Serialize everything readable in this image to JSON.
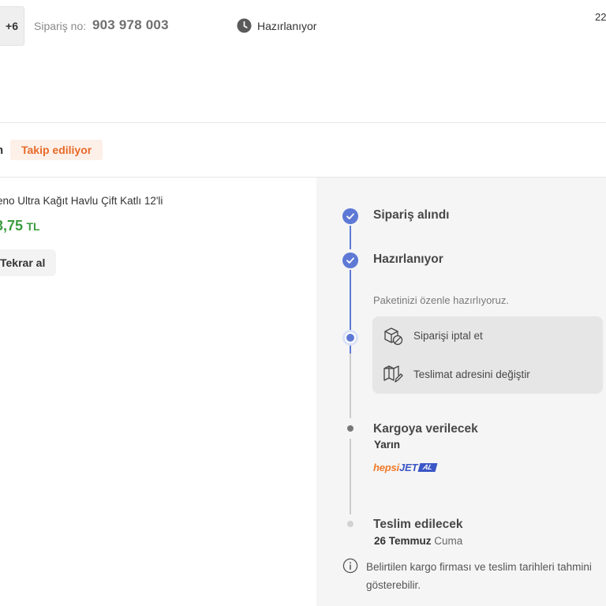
{
  "header": {
    "more_items": "+6",
    "order_label": "Sipariş no:",
    "order_number": "903 978 003",
    "status": "Hazırlanıyor",
    "date_fragment": "22"
  },
  "tracking": {
    "left_fragment": "n",
    "badge": "Takip ediliyor"
  },
  "product": {
    "name": "eno Ultra Kağıt Havlu Çift Katlı 12'li",
    "price": "3,75",
    "currency": "TL",
    "rebuy_label": "Tekrar al"
  },
  "timeline": {
    "steps": [
      {
        "title": "Sipariş alındı",
        "state": "done"
      },
      {
        "title": "Hazırlanıyor",
        "state": "done"
      },
      {
        "description": "Paketinizi özenle hazırlıyoruz.",
        "state": "current"
      },
      {
        "title": "Kargoya verilecek",
        "detail": "Yarın",
        "state": "pending"
      },
      {
        "title": "Teslim edilecek",
        "detail_date": "26 Temmuz",
        "detail_weekday": "Cuma",
        "state": "upcoming"
      }
    ],
    "actions": [
      {
        "label": "Siparişi iptal et",
        "icon": "box-cancel-icon"
      },
      {
        "label": "Teslimat adresini değiştir",
        "icon": "map-edit-icon"
      }
    ],
    "carrier_logo": {
      "part1": "hepsi",
      "part2": "JET",
      "part3": "AL"
    },
    "info_text": "Belirtilen kargo firması ve teslim tarihleri tahmini gösterebilir."
  },
  "colors": {
    "accent_blue": "#5e79d5",
    "price_green": "#3a9c3f",
    "badge_orange": "#e86a2a",
    "badge_bg": "#fdf0e8",
    "panel_bg": "#f5f5f5"
  }
}
